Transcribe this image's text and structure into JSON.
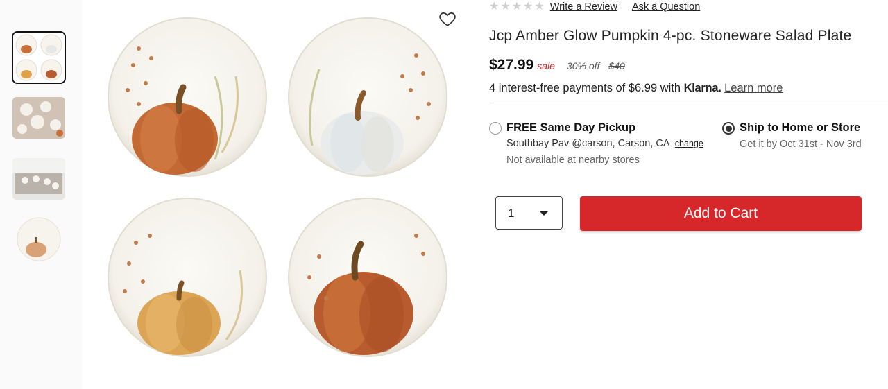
{
  "gallery": {
    "thumbnails": [
      {
        "name": "thumb-four-plates",
        "active": true
      },
      {
        "name": "thumb-table-setting",
        "active": false
      },
      {
        "name": "thumb-dining-room",
        "active": false
      },
      {
        "name": "thumb-single-plate",
        "active": false
      }
    ]
  },
  "rating": {
    "stars": [
      "★",
      "★",
      "★",
      "★",
      "★"
    ],
    "write_review": "Write a Review",
    "ask_question": "Ask a Question"
  },
  "product": {
    "title": "Jcp Amber Glow Pumpkin 4-pc. Stoneware Salad Plate",
    "price": "$27.99",
    "sale_label": "sale",
    "discount": "30% off",
    "original_price": "$40"
  },
  "klarna": {
    "text": "4 interest-free payments of $6.99 with",
    "brand": "Klarna.",
    "learn_more": "Learn more"
  },
  "fulfillment": {
    "pickup": {
      "title": "FREE Same Day Pickup",
      "store": "Southbay Pav @carson, Carson, CA",
      "change": "change",
      "availability": "Not available at nearby stores",
      "selected": false
    },
    "ship": {
      "title": "Ship to Home or Store",
      "eta": "Get it by Oct 31st - Nov 3rd",
      "selected": true
    }
  },
  "cart": {
    "quantity": "1",
    "add_label": "Add to Cart"
  },
  "colors": {
    "accent": "#d6282b",
    "sale": "#cc2427"
  }
}
